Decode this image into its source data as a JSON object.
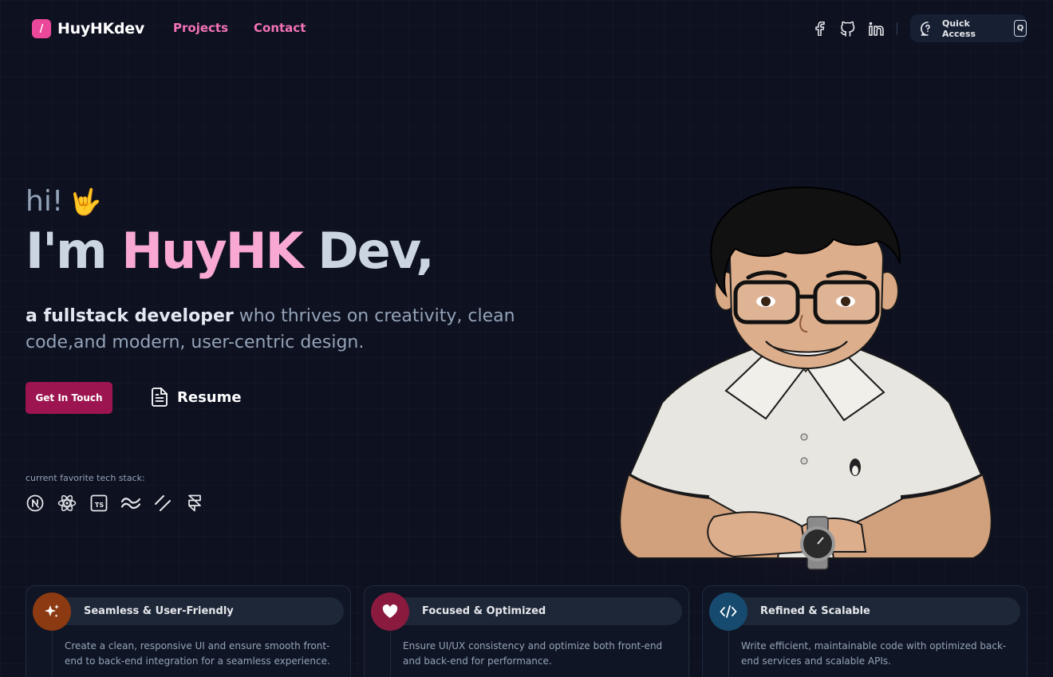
{
  "brand": {
    "mark": "/",
    "name": "HuyHKdev",
    "accent": "#ec4899"
  },
  "nav": {
    "items": [
      "Projects",
      "Contact"
    ]
  },
  "socials": [
    "facebook-icon",
    "github-icon",
    "linkedin-icon"
  ],
  "quick_access": {
    "label": "Quick Access",
    "shortcut": "Q"
  },
  "hero": {
    "greeting": "hi!",
    "greeting_emoji": "🤟",
    "headline_prefix": "I'm ",
    "headline_name": "HuyHK",
    "headline_suffix": " Dev,",
    "role": "a fullstack developer",
    "description": " who thrives on creativity, clean code,and modern, user-centric design.",
    "cta_primary": "Get In Touch",
    "cta_secondary": "Resume"
  },
  "tech_stack": {
    "label": "current favorite tech stack:",
    "icons": [
      "nextjs-icon",
      "react-icon",
      "typescript-icon",
      "tailwind-icon",
      "shadcn-icon",
      "framer-icon"
    ]
  },
  "features": [
    {
      "title": "Seamless & User-Friendly",
      "description": "Create a clean, responsive UI and ensure smooth front-end to back-end integration for a seamless experience.",
      "icon": "sparkles-icon",
      "color": "#8b3a12"
    },
    {
      "title": "Focused & Optimized",
      "description": "Ensure UI/UX consistency and optimize both front-end and back-end for performance.",
      "icon": "heart-icon",
      "color": "#8b1a3f"
    },
    {
      "title": "Refined & Scalable",
      "description": "Write efficient, maintainable code with optimized back-end services and scalable APIs.",
      "icon": "code-icon",
      "color": "#164a6e"
    }
  ]
}
